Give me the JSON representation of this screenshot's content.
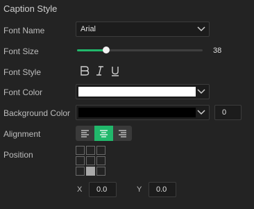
{
  "panel": {
    "title": "Caption Style"
  },
  "font_name": {
    "label": "Font Name",
    "value": "Arial"
  },
  "font_size": {
    "label": "Font Size",
    "value": "38",
    "slider_fraction": 0.23
  },
  "font_style": {
    "label": "Font Style",
    "buttons": [
      "bold-icon",
      "italic-icon",
      "underline-icon"
    ]
  },
  "font_color": {
    "label": "Font Color",
    "color": "#ffffff"
  },
  "background_color": {
    "label": "Background Color",
    "color": "#000000",
    "opacity": "0"
  },
  "alignment": {
    "label": "Alignment",
    "options": [
      "align-left-icon",
      "align-center-icon",
      "align-right-icon"
    ],
    "selected": "center"
  },
  "position": {
    "label": "Position",
    "selected_cell": "bottom-center"
  },
  "coords": {
    "x_label": "X",
    "x_value": "0.0",
    "y_label": "Y",
    "y_value": "0.0"
  },
  "colors": {
    "accent": "#21b86b",
    "background": "#232323"
  }
}
